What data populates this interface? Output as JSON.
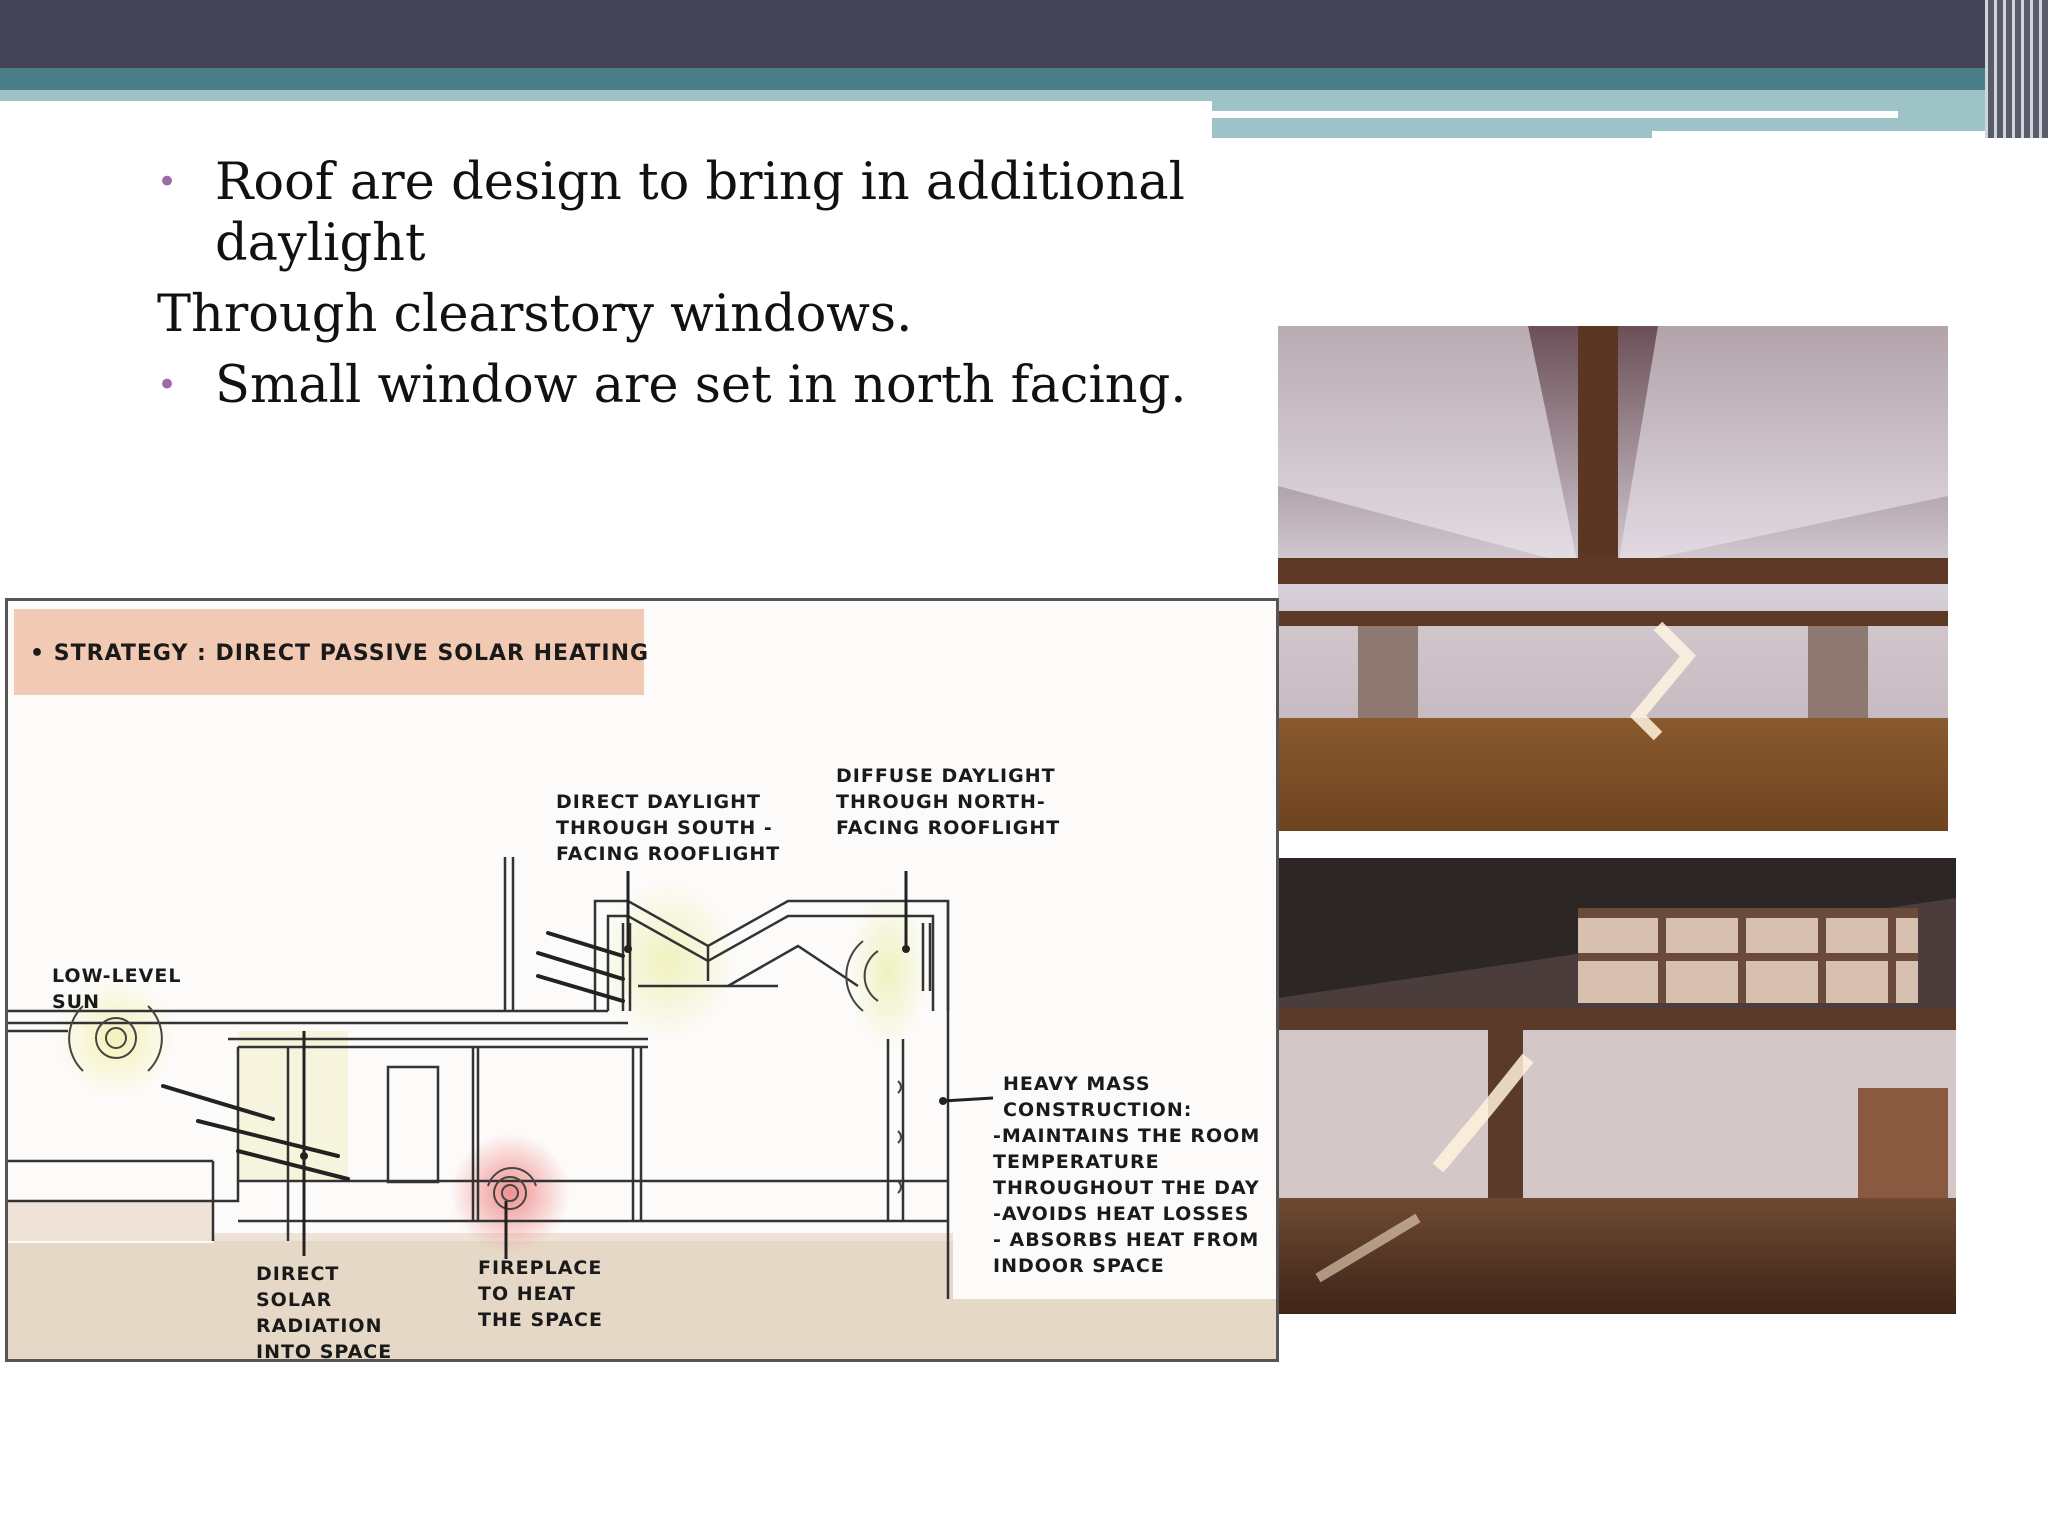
{
  "slide": {
    "bullets_text": {
      "b1": "Roof are design to bring in additional daylight",
      "p1": "Through clearstory windows.",
      "b2": "Small window are set in north facing."
    },
    "bullet_glyph": "•"
  },
  "diagram": {
    "strategy": "• STRATEGY : DIRECT PASSIVE SOLAR HEATING",
    "labels": {
      "low_sun": "LOW-LEVEL SUN",
      "direct_daylight": "DIRECT DAYLIGHT THROUGH SOUTH - FACING ROOFLIGHT",
      "diffuse_daylight": "DIFFUSE DAYLIGHT THROUGH NORTH-FACING ROOFLIGHT",
      "heavy_mass": "HEAVY MASS CONSTRUCTION:",
      "heavy_1": "-MAINTAINS THE ROOM TEMPERATURE THROUGHOUT THE DAY",
      "heavy_2": "-AVOIDS HEAT LOSSES",
      "heavy_3": "- ABSORBS HEAT FROM INDOOR SPACE",
      "direct_solar": "DIRECT SOLAR RADIATION INTO SPACE",
      "fireplace": "FIREPLACE TO HEAT THE SPACE"
    }
  },
  "colors": {
    "header_dark": "#454457",
    "header_teal": "#4b7f88",
    "header_light": "#9ec3c6",
    "bullet": "#9b6aa8",
    "strategy_box": "#f2c9b3",
    "ground": "#e6d8c6"
  }
}
